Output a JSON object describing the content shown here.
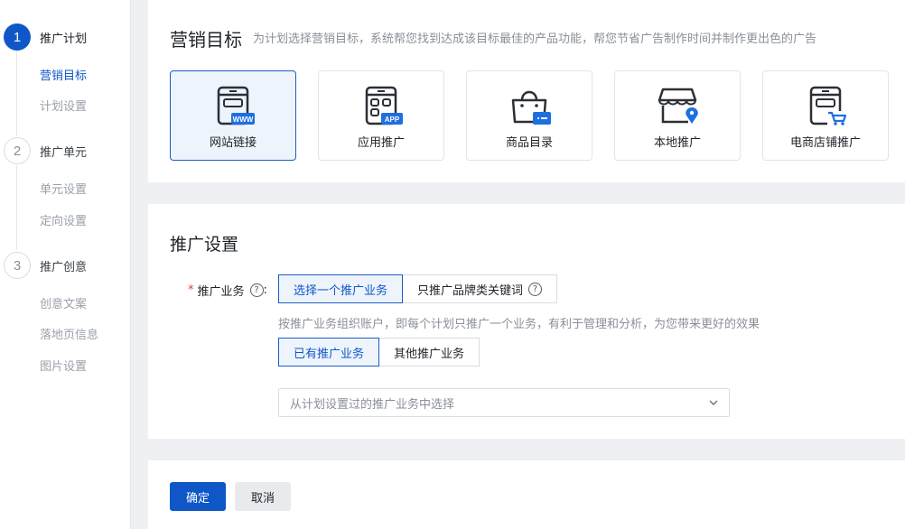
{
  "sidebar": {
    "steps": [
      {
        "number": "1",
        "label": "推广计划",
        "state": "active"
      },
      {
        "number": "2",
        "label": "推广单元",
        "state": "inactive"
      },
      {
        "number": "3",
        "label": "推广创意",
        "state": "inactive"
      }
    ],
    "substeps": [
      {
        "label": "营销目标",
        "state": "active"
      },
      {
        "label": "计划设置",
        "state": "inactive"
      },
      {
        "label": "单元设置",
        "state": "inactive"
      },
      {
        "label": "定向设置",
        "state": "inactive"
      },
      {
        "label": "创意文案",
        "state": "inactive"
      },
      {
        "label": "落地页信息",
        "state": "inactive"
      },
      {
        "label": "图片设置",
        "state": "inactive"
      }
    ]
  },
  "marketing_goal": {
    "title": "营销目标",
    "description": "为计划选择营销目标，系统帮您找到达成该目标最佳的产品功能，帮您节省广告制作时间并制作更出色的广告",
    "tiles": [
      {
        "label": "网站链接",
        "icon": "website-icon",
        "badge": "WWW",
        "selected": true
      },
      {
        "label": "应用推广",
        "icon": "app-icon",
        "badge": "APP",
        "selected": false
      },
      {
        "label": "商品目录",
        "icon": "shopping-bag-icon",
        "selected": false
      },
      {
        "label": "本地推广",
        "icon": "local-store-icon",
        "selected": false
      },
      {
        "label": "电商店铺推广",
        "icon": "ecommerce-store-icon",
        "selected": false
      }
    ]
  },
  "promotion_settings": {
    "title": "推广设置",
    "business_label": "推广业务",
    "business_label_suffix": ":",
    "required_mark": "*",
    "help_glyph": "?",
    "business_options": [
      {
        "label": "选择一个推广业务",
        "selected": true
      },
      {
        "label": "只推广品牌类关键词",
        "selected": false
      }
    ],
    "hint": "按推广业务组织账户，即每个计划只推广一个业务，有利于管理和分析，为您带来更好的效果",
    "source_options": [
      {
        "label": "已有推广业务",
        "selected": true
      },
      {
        "label": "其他推广业务",
        "selected": false
      }
    ],
    "select_placeholder": "从计划设置过的推广业务中选择"
  },
  "actions": {
    "confirm_label": "确定",
    "cancel_label": "取消"
  },
  "colors": {
    "accent": "#0f57c7",
    "selected_bg": "#eef4fc",
    "required": "#e0393e",
    "page_bg": "#eef0f4"
  }
}
